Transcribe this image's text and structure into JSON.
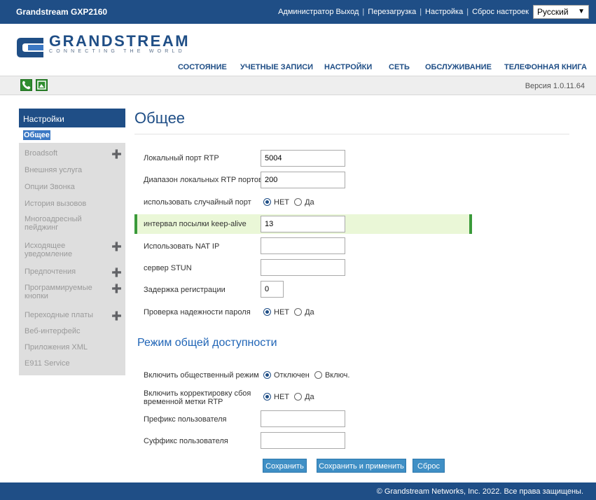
{
  "header": {
    "product": "Grandstream GXP2160",
    "links": [
      "Администратор Выход",
      "Перезагрузка",
      "Настройка",
      "Сброс настроек"
    ],
    "language": "Русский"
  },
  "logo": {
    "name": "GRANDSTREAM",
    "tagline": "CONNECTING THE WORLD"
  },
  "mainnav": [
    "СОСТОЯНИЕ",
    "УЧЕТНЫЕ ЗАПИСИ",
    "НАСТРОЙКИ",
    "СЕТЬ",
    "ОБСЛУЖИВАНИЕ",
    "ТЕЛЕФОННАЯ КНИГА"
  ],
  "version": "Версия 1.0.11.64",
  "sidebar": {
    "heading": "Настройки",
    "active": "Общее",
    "items": [
      {
        "label": "Broadsoft",
        "expandable": true
      },
      {
        "label": "Внешняя услуга",
        "expandable": false
      },
      {
        "label": "Опции Звонка",
        "expandable": false
      },
      {
        "label": "История вызовов",
        "expandable": false
      },
      {
        "label": "Многоадресный пейджинг",
        "expandable": false
      },
      {
        "label": "Исходящее уведомление",
        "expandable": true
      },
      {
        "label": "Предпочтения",
        "expandable": true
      },
      {
        "label": "Программируемые кнопки",
        "expandable": true
      },
      {
        "label": "Переходные платы",
        "expandable": true
      },
      {
        "label": "Веб-интерфейс",
        "expandable": false
      },
      {
        "label": "Приложения XML",
        "expandable": false
      },
      {
        "label": "E911 Service",
        "expandable": false
      }
    ]
  },
  "page": {
    "title": "Общее",
    "section2_title": "Режим общей доступности"
  },
  "form": {
    "rtp_port": {
      "label": "Локальный порт RTP",
      "value": "5004"
    },
    "rtp_range": {
      "label": "Диапазон локальных RTP портов",
      "value": "200"
    },
    "random_port": {
      "label": "использовать случайный порт",
      "options": [
        "НЕТ",
        "Да"
      ],
      "selected": "НЕТ"
    },
    "keepalive": {
      "label": "интервал посылки keep-alive",
      "value": "13"
    },
    "nat_ip": {
      "label": "Использовать NAT IP",
      "value": ""
    },
    "stun": {
      "label": "сервер STUN",
      "value": ""
    },
    "reg_delay": {
      "label": "Задержка регистрации",
      "value": "0"
    },
    "pwd_check": {
      "label": "Проверка надежности пароля",
      "options": [
        "НЕТ",
        "Да"
      ],
      "selected": "НЕТ"
    },
    "public_mode": {
      "label": "Включить общественный режим",
      "options": [
        "Отключен",
        "Включ."
      ],
      "selected": "Отключен"
    },
    "rtp_timestamp": {
      "label_line1": "Включить корректировку сбоя",
      "label_line2": "временной метки RTP",
      "options": [
        "НЕТ",
        "Да"
      ],
      "selected": "НЕТ"
    },
    "user_prefix": {
      "label": "Префикс пользователя",
      "value": ""
    },
    "user_suffix": {
      "label": "Суффикс пользователя",
      "value": ""
    }
  },
  "buttons": {
    "save": "Сохранить",
    "save_apply": "Сохранить и применить",
    "reset": "Сброс"
  },
  "footer": "© Grandstream Networks, Inc. 2022. Все права защищены.",
  "colors": {
    "brand": "#1f4e86",
    "button": "#3f8fc5",
    "highlight_row": "#eaf7d7",
    "highlight_border": "#3a9a3a"
  }
}
